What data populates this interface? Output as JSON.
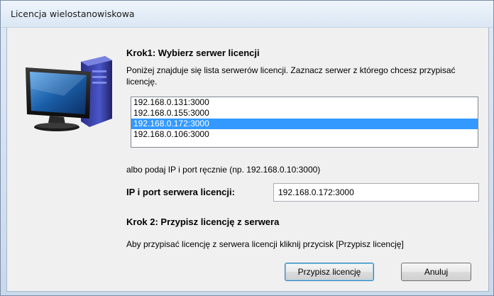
{
  "window": {
    "title": "Licencja wielostanowiskowa"
  },
  "step1": {
    "heading": "Krok1: Wybierz serwer licencji",
    "description": "Poniżej znajduje się lista serwerów licencji. Zaznacz serwer z którego chcesz przypisać licencję."
  },
  "servers": [
    {
      "address": "192.168.0.131:3000",
      "selected": false
    },
    {
      "address": "192.168.0.155:3000",
      "selected": false
    },
    {
      "address": "192.168.0.172:3000",
      "selected": true
    },
    {
      "address": "192.168.0.106:3000",
      "selected": false
    }
  ],
  "manual": {
    "hint": "albo podaj IP i port ręcznie (np. 192.168.0.10:3000)",
    "label": "IP i port serwera licencji:",
    "value": "192.168.0.172:3000"
  },
  "step2": {
    "heading": "Krok 2: Przypisz licencję z serwera",
    "description": "Aby przypisać licencję z serwera licencji kliknij przycisk [Przypisz licencję]"
  },
  "buttons": {
    "assign_label": "Przypisz licencję",
    "cancel_label": "Anuluj"
  },
  "colors": {
    "selection": "#3399ff",
    "monitor_screen": "#1b5fa8"
  },
  "icons": {
    "computer": "computer-icon"
  }
}
